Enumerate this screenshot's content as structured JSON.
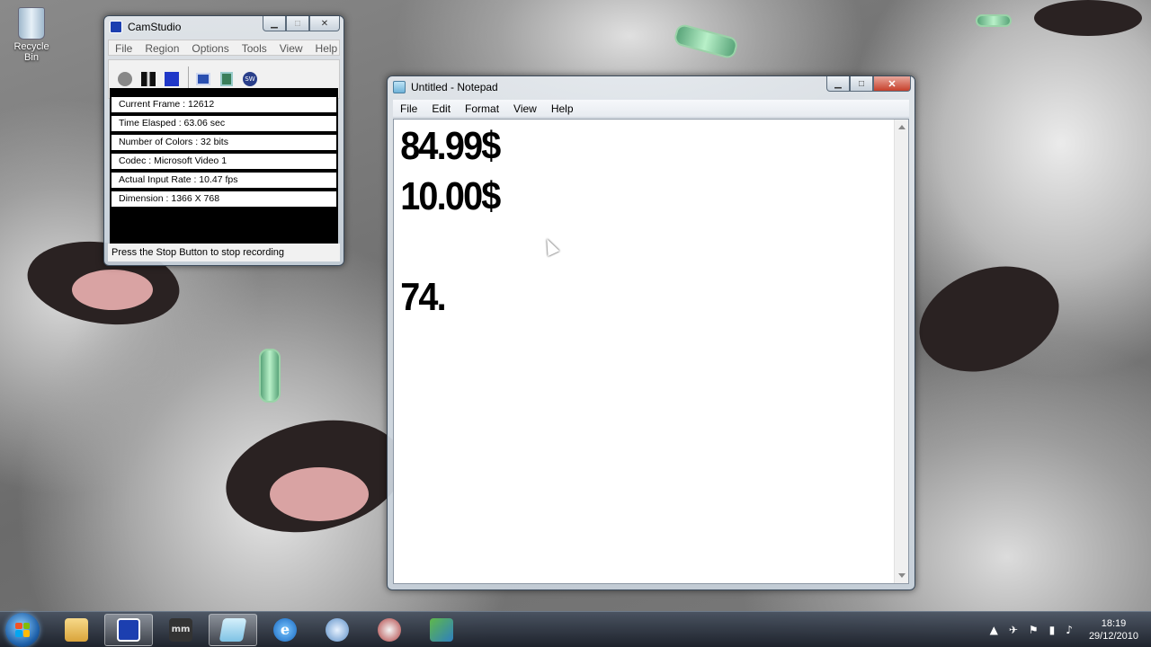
{
  "desktop": {
    "recycle_bin_label": "Recycle Bin"
  },
  "camstudio": {
    "title": "CamStudio",
    "menu": [
      "File",
      "Region",
      "Options",
      "Tools",
      "View",
      "Help"
    ],
    "toolbar_icons": [
      "record-icon",
      "pause-icon",
      "stop-icon",
      "region-icon",
      "options-icon",
      "swf-icon"
    ],
    "stats": [
      "Current Frame : 12612",
      "Time Elasped : 63.06 sec",
      "Number of Colors : 32 bits",
      "Codec : Microsoft Video 1",
      "Actual Input Rate : 10.47 fps",
      "Dimension : 1366 X 768"
    ],
    "status": "Press the Stop Button to stop recording"
  },
  "notepad": {
    "title": "Untitled - Notepad",
    "menu": [
      "File",
      "Edit",
      "Format",
      "View",
      "Help"
    ],
    "lines": [
      "84.99$",
      "10.00$",
      "",
      "74."
    ]
  },
  "taskbar": {
    "clock_time": "18:19",
    "clock_date": "29/12/2010"
  },
  "colors": {
    "close_button": "#c6402b",
    "start_orb": "#1d5fa8"
  }
}
